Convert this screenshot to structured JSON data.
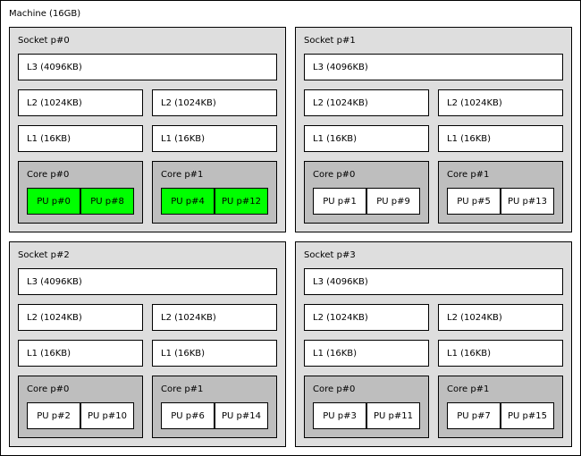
{
  "machine": {
    "label": "Machine (16GB)"
  },
  "sockets": [
    {
      "label": "Socket p#0",
      "l3": "L3 (4096KB)",
      "l2": [
        "L2 (1024KB)",
        "L2 (1024KB)"
      ],
      "l1": [
        "L1 (16KB)",
        "L1 (16KB)"
      ],
      "cores": [
        {
          "label": "Core p#0",
          "pus": [
            {
              "label": "PU p#0",
              "active": true
            },
            {
              "label": "PU p#8",
              "active": true
            }
          ]
        },
        {
          "label": "Core p#1",
          "pus": [
            {
              "label": "PU p#4",
              "active": true
            },
            {
              "label": "PU p#12",
              "active": true
            }
          ]
        }
      ]
    },
    {
      "label": "Socket p#1",
      "l3": "L3 (4096KB)",
      "l2": [
        "L2 (1024KB)",
        "L2 (1024KB)"
      ],
      "l1": [
        "L1 (16KB)",
        "L1 (16KB)"
      ],
      "cores": [
        {
          "label": "Core p#0",
          "pus": [
            {
              "label": "PU p#1",
              "active": false
            },
            {
              "label": "PU p#9",
              "active": false
            }
          ]
        },
        {
          "label": "Core p#1",
          "pus": [
            {
              "label": "PU p#5",
              "active": false
            },
            {
              "label": "PU p#13",
              "active": false
            }
          ]
        }
      ]
    },
    {
      "label": "Socket p#2",
      "l3": "L3 (4096KB)",
      "l2": [
        "L2 (1024KB)",
        "L2 (1024KB)"
      ],
      "l1": [
        "L1 (16KB)",
        "L1 (16KB)"
      ],
      "cores": [
        {
          "label": "Core p#0",
          "pus": [
            {
              "label": "PU p#2",
              "active": false
            },
            {
              "label": "PU p#10",
              "active": false
            }
          ]
        },
        {
          "label": "Core p#1",
          "pus": [
            {
              "label": "PU p#6",
              "active": false
            },
            {
              "label": "PU p#14",
              "active": false
            }
          ]
        }
      ]
    },
    {
      "label": "Socket p#3",
      "l3": "L3 (4096KB)",
      "l2": [
        "L2 (1024KB)",
        "L2 (1024KB)"
      ],
      "l1": [
        "L1 (16KB)",
        "L1 (16KB)"
      ],
      "cores": [
        {
          "label": "Core p#0",
          "pus": [
            {
              "label": "PU p#3",
              "active": false
            },
            {
              "label": "PU p#11",
              "active": false
            }
          ]
        },
        {
          "label": "Core p#1",
          "pus": [
            {
              "label": "PU p#7",
              "active": false
            },
            {
              "label": "PU p#15",
              "active": false
            }
          ]
        }
      ]
    }
  ],
  "colors": {
    "active_pu": "#00ff00",
    "socket_bg": "#dedede",
    "core_bg": "#bebebe"
  }
}
